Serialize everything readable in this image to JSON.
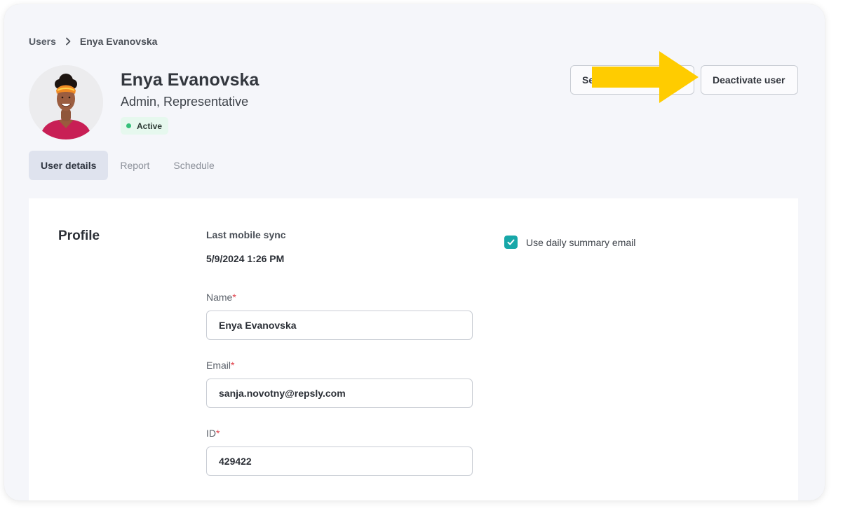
{
  "breadcrumb": {
    "parent": "Users",
    "current": "Enya Evanovska",
    "separator_icon": "chevron-right-icon"
  },
  "user": {
    "name": "Enya Evanovska",
    "roles": "Admin, Representative",
    "status": "Active",
    "status_color": "#36c07a"
  },
  "header_actions": {
    "secondary_button_label_visible": "Se",
    "deactivate_label": "Deactivate user"
  },
  "annotation": {
    "arrow_color": "#ffcc00",
    "arrow_icon": "arrow-right-icon"
  },
  "tabs": [
    {
      "label": "User details",
      "active": true
    },
    {
      "label": "Report",
      "active": false
    },
    {
      "label": "Schedule",
      "active": false
    }
  ],
  "profile": {
    "section_title": "Profile",
    "last_sync_label": "Last mobile sync",
    "last_sync_value": "5/9/2024 1:26 PM",
    "fields": [
      {
        "label": "Name",
        "required_mark": "*",
        "value": "Enya Evanovska"
      },
      {
        "label": "Email",
        "required_mark": "*",
        "value": "sanja.novotny@repsly.com"
      },
      {
        "label": "ID",
        "required_mark": "*",
        "value": "429422"
      }
    ],
    "daily_summary": {
      "label": "Use daily summary email",
      "checked": true
    },
    "accent_color": "#17a7a8"
  }
}
